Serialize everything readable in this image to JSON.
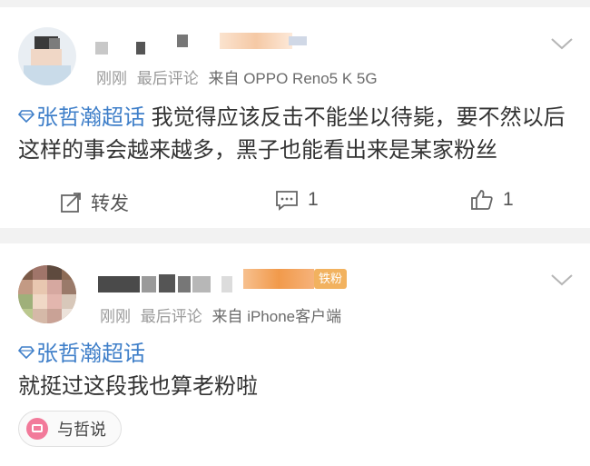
{
  "posts": [
    {
      "time": "刚刚",
      "sort_label": "最后评论",
      "source": "来自 OPPO Reno5 K 5G",
      "topic": "张哲瀚超话",
      "text": "我觉得应该反击不能坐以待毙，要不然以后这样的事会越来越多，黑子也能看出来是某家粉丝",
      "actions": {
        "repost": "转发",
        "comment": "1",
        "like": "1"
      }
    },
    {
      "time": "刚刚",
      "sort_label": "最后评论",
      "source": "来自 iPhone客户端",
      "badge": "铁粉",
      "topic": "张哲瀚超话",
      "text": "就挺过这段我也算老粉啦",
      "chip": "与哲说"
    }
  ],
  "colors": {
    "topic": "#3f7fc9",
    "meta": "#9a9a9a",
    "badge": "#f0a33a"
  },
  "icons": [
    "chevron-down-icon",
    "gem-icon",
    "repost-icon",
    "comment-icon",
    "like-icon",
    "chat-chip-icon"
  ]
}
